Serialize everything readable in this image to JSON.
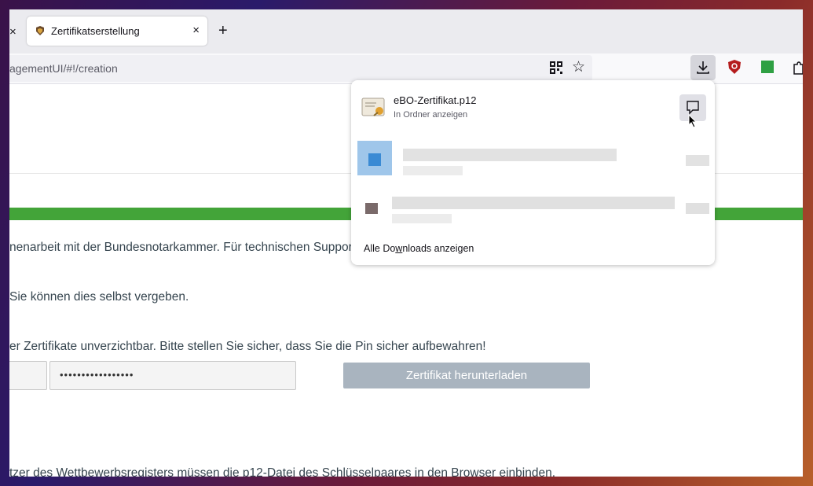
{
  "tabs": {
    "active": {
      "title": "Zertifikatserstellung",
      "close": "×"
    },
    "left_close": "×",
    "new_tab": "+"
  },
  "navbar": {
    "url": "agementUI/#!/creation",
    "star": "☆",
    "extensions": "⚙"
  },
  "page": {
    "line1": "nenarbeit mit der Bundesnotarkammer. Für technischen Suppor",
    "line2": "Sie können dies selbst vergeben.",
    "line3": "er Zertifikate unverzichtbar. Bitte stellen Sie sicher, dass Sie die Pin sicher aufbewahren!",
    "pin_value": "•••••••••••••••••",
    "download_button": "Zertifikat herunterladen",
    "line4": "tzer des Wettbewerbsregisters müssen die p12-Datei des Schlüsselpaares in den Browser einbinden."
  },
  "downloads_panel": {
    "file_name": "eBO-Zertifikat.p12",
    "file_sub": "In Ordner anzeigen",
    "show_all_prefix": "Alle Do",
    "show_all_access": "w",
    "show_all_suffix": "nloads anzeigen"
  },
  "colors": {
    "accent_green": "#43a439",
    "button_disabled": "#a9b4bf",
    "text": "#36454f"
  }
}
